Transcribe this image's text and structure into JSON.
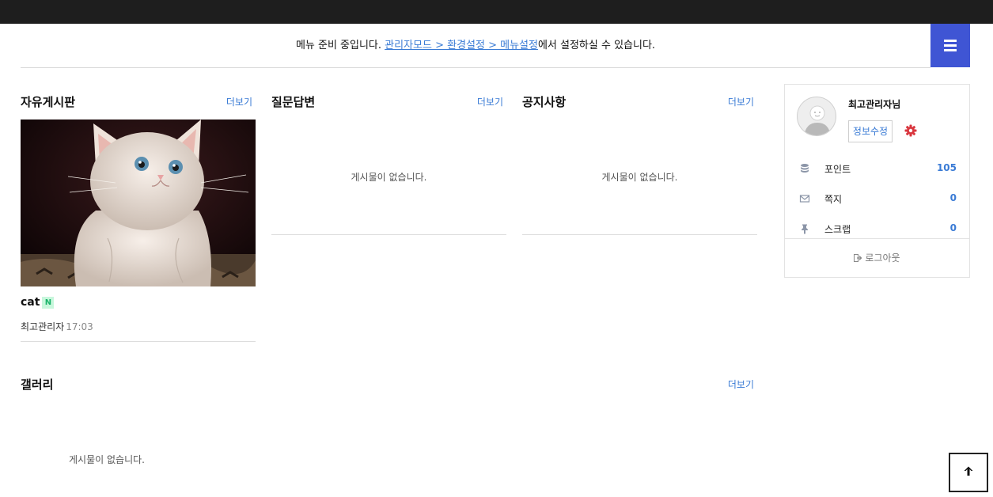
{
  "notice": {
    "prefix": "메뉴 준비 중입니다. ",
    "link": "관리자모드 > 환경설정 > 메뉴설정",
    "suffix": "에서 설정하실 수 있습니다."
  },
  "boards": {
    "free": {
      "title": "자유게시판",
      "more": "더보기"
    },
    "qna": {
      "title": "질문답변",
      "more": "더보기",
      "empty": "게시물이 없습니다."
    },
    "notice": {
      "title": "공지사항",
      "more": "더보기",
      "empty": "게시물이 없습니다."
    },
    "gallery": {
      "title": "갤러리",
      "more": "더보기",
      "empty": "게시물이 없습니다."
    }
  },
  "post": {
    "title": "cat",
    "badge": "N",
    "author": "최고관리자",
    "time": "17:03"
  },
  "profile": {
    "nickname": "최고관리자님",
    "edit_label": "정보수정",
    "stats": [
      {
        "label": "포인트",
        "value": "105",
        "icon": "database-icon"
      },
      {
        "label": "쪽지",
        "value": "0",
        "icon": "envelope-icon"
      },
      {
        "label": "스크랩",
        "value": "0",
        "icon": "pin-icon"
      }
    ],
    "logout_label": "로그아웃"
  },
  "colors": {
    "topbar": "#1e1e1e",
    "accent": "#3f55d4",
    "link": "#3a7bd5",
    "gear": "#d9363e"
  }
}
